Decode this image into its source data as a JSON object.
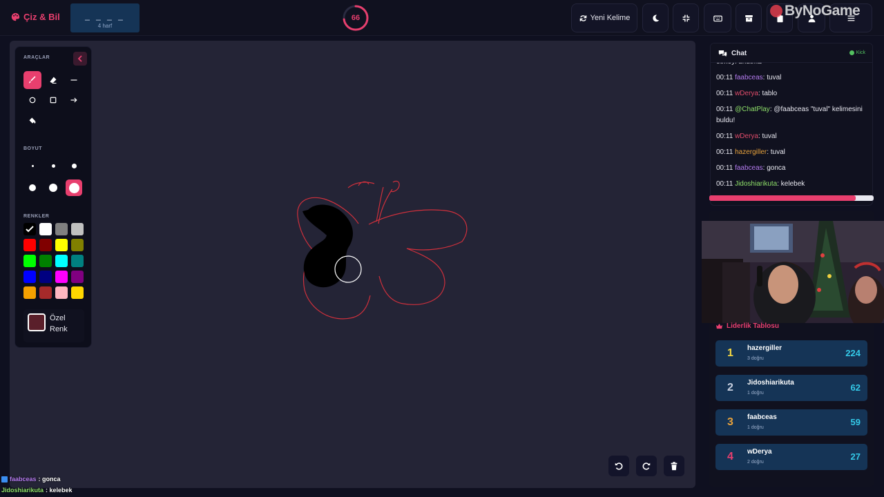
{
  "brand": {
    "name": "Çiz & Bil"
  },
  "word": {
    "mask": "_ _ _ _",
    "length_label": "4 harf"
  },
  "timer": {
    "seconds": "66",
    "fraction": 0.73
  },
  "toolbar": {
    "new_word_label": "Yeni Kelime"
  },
  "watermark": {
    "text": "ByNoGame"
  },
  "tools": {
    "section_tools": "ARAÇLAR",
    "section_size": "BOYUT",
    "section_colors": "RENKLER",
    "custom_color_label": "Özel Renk"
  },
  "colors": {
    "swatches": [
      "#000000",
      "#ffffff",
      "#808080",
      "#c0c0c0",
      "#ff0000",
      "#800000",
      "#ffff00",
      "#808000",
      "#00ff00",
      "#008000",
      "#00ffff",
      "#008080",
      "#0000ff",
      "#000080",
      "#ff00ff",
      "#800080",
      "#f5a000",
      "#a52a2a",
      "#ffb6c1",
      "#ffd700"
    ],
    "custom": "#5a1f2a",
    "accent": "#e83f6e"
  },
  "chat": {
    "title": "Chat",
    "platform": "Kick",
    "messages": [
      {
        "time": "",
        "user": "",
        "text": "etmeyi unutma",
        "color": "#e8e8f0"
      },
      {
        "time": "00:11",
        "user": "faabceas",
        "text": ": tuval",
        "color": "#b57cf0"
      },
      {
        "time": "00:11",
        "user": "wDerya",
        "text": ": tablo",
        "color": "#e04c6a"
      },
      {
        "time": "00:11",
        "user": "@ChatPlay",
        "text": ": @faabceas \"tuval\" kelimesini buldu!",
        "color": "#8fe06a"
      },
      {
        "time": "00:11",
        "user": "wDerya",
        "text": ": tuval",
        "color": "#e04c6a"
      },
      {
        "time": "00:11",
        "user": "hazergiller",
        "text": ": tuval",
        "color": "#e8a23c"
      },
      {
        "time": "00:11",
        "user": "faabceas",
        "text": ": gonca",
        "color": "#b57cf0"
      },
      {
        "time": "00:11",
        "user": "Jidoshiarikuta",
        "text": ": kelebek",
        "color": "#8fe06a"
      }
    ],
    "progress": 0.89
  },
  "leaderboard": {
    "title": "Liderlik Tablosu",
    "rows": [
      {
        "rank": "1",
        "name": "hazergiller",
        "correct": "3 doğru",
        "score": "224",
        "color": "#f5d742"
      },
      {
        "rank": "2",
        "name": "Jidoshiarikuta",
        "correct": "1 doğru",
        "score": "62",
        "color": "#c8d0e0"
      },
      {
        "rank": "3",
        "name": "faabceas",
        "correct": "1 doğru",
        "score": "59",
        "color": "#e8a23c"
      },
      {
        "rank": "4",
        "name": "wDerya",
        "correct": "2 doğru",
        "score": "27",
        "color": "#e83f6e"
      }
    ]
  },
  "overlay_chat": [
    {
      "user": "faabceas",
      "text": " : gonca",
      "color": "#b57cf0"
    },
    {
      "user": "Jidoshiarikuta",
      "text": " : kelebek",
      "color": "#8fe06a"
    }
  ]
}
